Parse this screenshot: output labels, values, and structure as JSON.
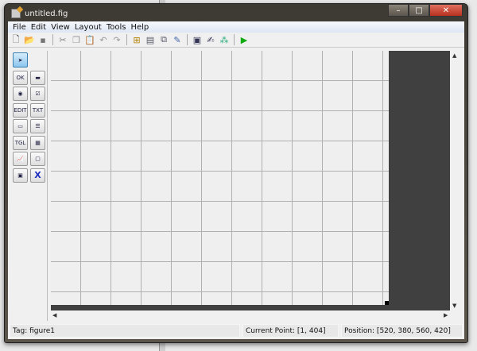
{
  "window": {
    "title": "untitled.fig",
    "minimize": "–",
    "maximize": "□",
    "close": "✕"
  },
  "menu": [
    "File",
    "Edit",
    "View",
    "Layout",
    "Tools",
    "Help"
  ],
  "toolbar": [
    {
      "icon": "new-icon",
      "glyph": "🗋"
    },
    {
      "icon": "open-icon",
      "glyph": "📂"
    },
    {
      "icon": "save-icon",
      "glyph": "▪"
    },
    {
      "icon": "cut-icon",
      "glyph": "✂"
    },
    {
      "icon": "copy-icon",
      "glyph": "❐"
    },
    {
      "icon": "paste-icon",
      "glyph": "📋"
    },
    {
      "icon": "undo-icon",
      "glyph": "↶"
    },
    {
      "icon": "redo-icon",
      "glyph": "↷"
    },
    {
      "icon": "align-icon",
      "glyph": "⊞"
    },
    {
      "icon": "menu-editor-icon",
      "glyph": "▤"
    },
    {
      "icon": "tab-order-icon",
      "glyph": "⧉"
    },
    {
      "icon": "toolbar-editor-icon",
      "glyph": "✎"
    },
    {
      "icon": "m-file-editor-icon",
      "glyph": "▣"
    },
    {
      "icon": "property-inspector-icon",
      "glyph": "✍"
    },
    {
      "icon": "object-browser-icon",
      "glyph": "⁂"
    },
    {
      "icon": "run-icon",
      "glyph": "▶"
    }
  ],
  "palette": [
    {
      "name": "select-tool",
      "glyph": "➤"
    },
    {
      "name": "push-button-tool",
      "glyph": "OK"
    },
    {
      "name": "slider-tool",
      "glyph": "▬"
    },
    {
      "name": "radio-button-tool",
      "glyph": "◉"
    },
    {
      "name": "checkbox-tool",
      "glyph": "☑"
    },
    {
      "name": "edit-text-tool",
      "glyph": "EDIT"
    },
    {
      "name": "static-text-tool",
      "glyph": "TXT"
    },
    {
      "name": "popup-menu-tool",
      "glyph": "▭"
    },
    {
      "name": "listbox-tool",
      "glyph": "☰"
    },
    {
      "name": "toggle-button-tool",
      "glyph": "TGL"
    },
    {
      "name": "table-tool",
      "glyph": "▦"
    },
    {
      "name": "axes-tool",
      "glyph": "📈"
    },
    {
      "name": "panel-tool",
      "glyph": "▢"
    },
    {
      "name": "button-group-tool",
      "glyph": "▣"
    },
    {
      "name": "activex-tool",
      "glyph": "X"
    }
  ],
  "status": {
    "tag": "Tag: figure1",
    "current_point": "Current Point:  [1, 404]",
    "position": "Position: [520, 380, 560, 420]"
  }
}
